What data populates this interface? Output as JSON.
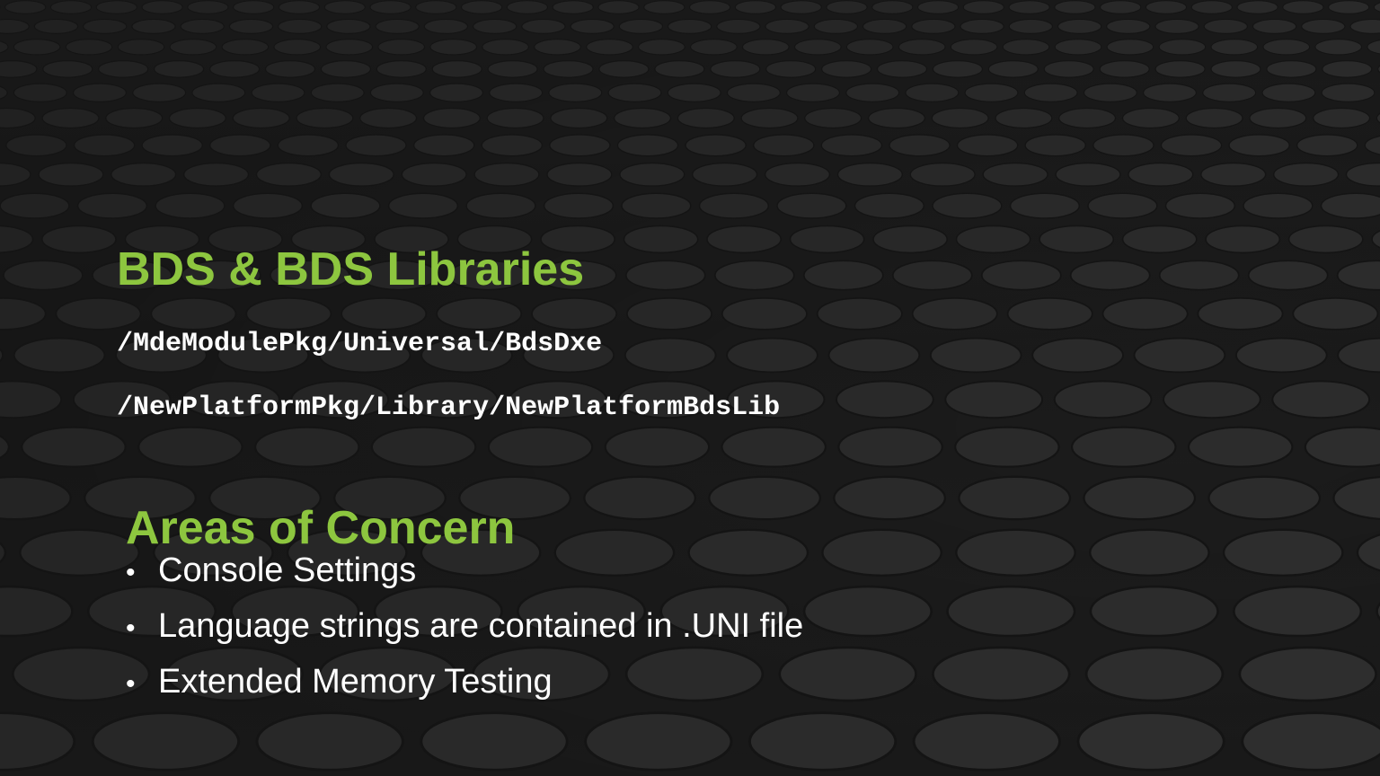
{
  "slide": {
    "title": "BDS & BDS Libraries",
    "paths": [
      "/MdeModulePkg/Universal/BdsDxe",
      "/NewPlatformPkg/Library/NewPlatformBdsLib"
    ],
    "subtitle": "Areas of Concern",
    "bullets": [
      "Console Settings",
      "Language strings are contained in .UNI file",
      "Extended Memory Testing"
    ],
    "bullet_glyph": "•"
  },
  "colors": {
    "accent": "#8dc63f",
    "text": "#ffffff",
    "background": "#1f1f1f"
  }
}
